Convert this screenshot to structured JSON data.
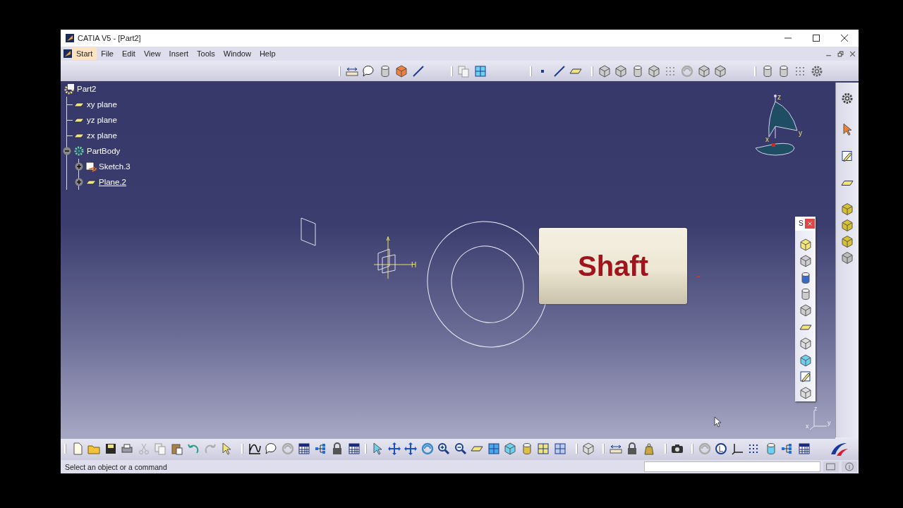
{
  "window": {
    "title": "CATIA V5 - [Part2]"
  },
  "menu": [
    {
      "label": "Start",
      "highlighted": true
    },
    {
      "label": "File",
      "highlighted": false
    },
    {
      "label": "Edit",
      "highlighted": false
    },
    {
      "label": "View",
      "highlighted": false
    },
    {
      "label": "Insert",
      "highlighted": false
    },
    {
      "label": "Tools",
      "highlighted": false
    },
    {
      "label": "Window",
      "highlighted": false
    },
    {
      "label": "Help",
      "highlighted": false
    }
  ],
  "tree": {
    "label": "Part2",
    "kind": "part",
    "children": [
      {
        "label": "xy plane",
        "kind": "plane",
        "underlined": false
      },
      {
        "label": "yz plane",
        "kind": "plane",
        "underlined": false
      },
      {
        "label": "zx plane",
        "kind": "plane",
        "underlined": false
      },
      {
        "label": "PartBody",
        "kind": "body",
        "underlined": false,
        "expanded": true,
        "children": [
          {
            "label": "Sketch.3",
            "kind": "sketch",
            "underlined": false,
            "expanded": false
          },
          {
            "label": "Plane.2",
            "kind": "plane",
            "underlined": true,
            "expanded": false
          }
        ]
      }
    ]
  },
  "compass": {
    "labels": [
      "z",
      "y",
      "x"
    ]
  },
  "sketch": {
    "axis_label": "H"
  },
  "callout": {
    "text": "Shaft"
  },
  "floating_toolbar": {
    "title": "S"
  },
  "corner_axis": {
    "labels": [
      "z",
      "x",
      "y"
    ]
  },
  "status_bar": {
    "message": "Select an object or a command"
  }
}
